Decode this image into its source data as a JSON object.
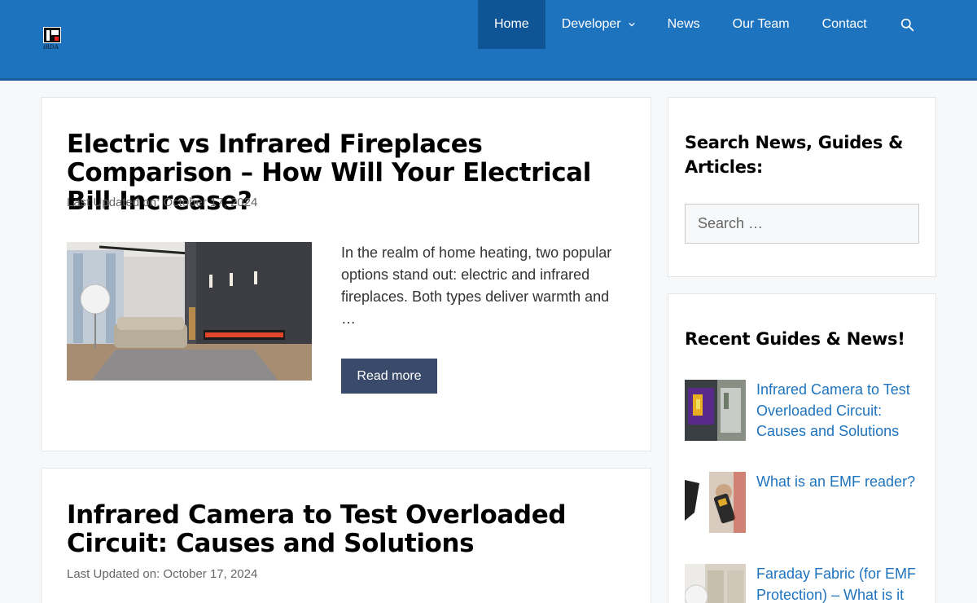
{
  "header": {
    "logo_text": "iRDA",
    "nav": [
      {
        "label": "Home",
        "active": true
      },
      {
        "label": "Developer",
        "has_dropdown": true
      },
      {
        "label": "News"
      },
      {
        "label": "Our Team"
      },
      {
        "label": "Contact"
      }
    ],
    "search_icon": "search-icon"
  },
  "posts": [
    {
      "title": "Electric vs Infrared Fireplaces Comparison – How Will Your Electrical Bill Increase?",
      "meta": "Last Updated on: October 17, 2024",
      "excerpt": "In the realm of home heating, two popular options stand out: electric and infrared fireplaces. Both types deliver warmth and …",
      "read_more": "Read more"
    },
    {
      "title": "Infrared Camera to Test Overloaded Circuit: Causes and Solutions",
      "meta": "Last Updated on: October 17, 2024"
    }
  ],
  "sidebar": {
    "search_widget": {
      "title": "Search News, Guides & Articles:",
      "placeholder": "Search …"
    },
    "recent_widget": {
      "title": "Recent Guides & News!",
      "items": [
        {
          "label": "Infrared Camera to Test Overloaded Circuit: Causes and Solutions"
        },
        {
          "label": "What is an EMF reader?"
        },
        {
          "label": "Faraday Fabric (for EMF Protection) – What is it"
        }
      ]
    }
  },
  "colors": {
    "header_bg": "#1e73be",
    "nav_active_bg": "#0f5596",
    "button_bg": "#3a4a6b",
    "link": "#1e73be"
  }
}
